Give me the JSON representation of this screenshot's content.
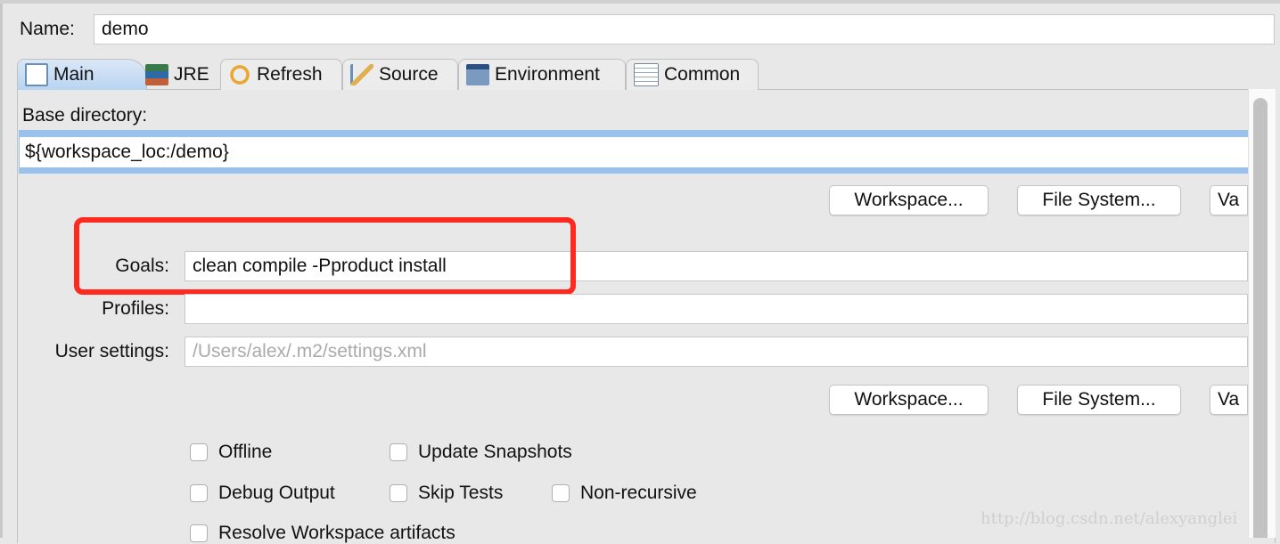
{
  "name": {
    "label": "Name:",
    "value": "demo"
  },
  "tabs": [
    {
      "label": "Main",
      "icon": "main-icon"
    },
    {
      "label": "JRE",
      "icon": "jre-icon"
    },
    {
      "label": "Refresh",
      "icon": "refresh-icon"
    },
    {
      "label": "Source",
      "icon": "source-icon"
    },
    {
      "label": "Environment",
      "icon": "environment-icon"
    },
    {
      "label": "Common",
      "icon": "common-icon"
    }
  ],
  "base_directory": {
    "label": "Base directory:",
    "value": "${workspace_loc:/demo}"
  },
  "buttons1": {
    "workspace": "Workspace...",
    "file_system": "File System...",
    "variables": "Va"
  },
  "goals": {
    "label": "Goals:",
    "value": "clean compile -Pproduct install"
  },
  "profiles": {
    "label": "Profiles:",
    "value": ""
  },
  "user_settings": {
    "label": "User settings:",
    "placeholder": "/Users/alex/.m2/settings.xml"
  },
  "buttons2": {
    "workspace": "Workspace...",
    "file_system": "File System...",
    "variables": "Va"
  },
  "checkboxes": [
    {
      "label": "Offline",
      "checked": false
    },
    {
      "label": "Update Snapshots",
      "checked": false
    },
    {
      "label": "Debug Output",
      "checked": false
    },
    {
      "label": "Skip Tests",
      "checked": false
    },
    {
      "label": "Non-recursive",
      "checked": false
    },
    {
      "label": "Resolve Workspace artifacts",
      "checked": false
    }
  ],
  "watermark": "http://blog.csdn.net/alexyanglei",
  "colors": {
    "highlight": "#ff2a1f",
    "focus": "#9ac0ec"
  }
}
